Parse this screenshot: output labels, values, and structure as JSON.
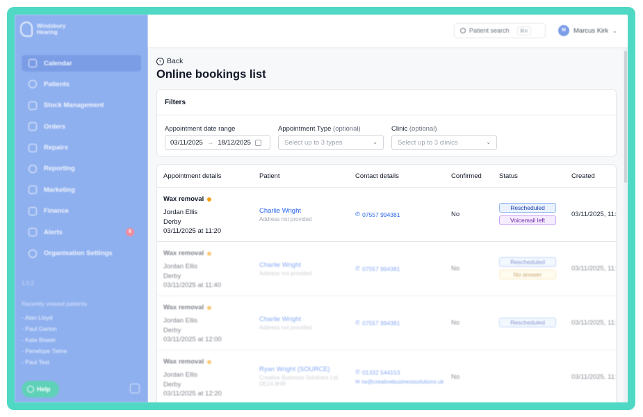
{
  "sidebar": {
    "logo_line1": "Windsbury",
    "logo_line2": "Hearing",
    "items": [
      {
        "label": "Calendar",
        "icon": "calendar-icon"
      },
      {
        "label": "Patients",
        "icon": "patients-icon"
      },
      {
        "label": "Stock Management",
        "icon": "stock-icon"
      },
      {
        "label": "Orders",
        "icon": "orders-icon"
      },
      {
        "label": "Repairs",
        "icon": "wrench-icon"
      },
      {
        "label": "Reporting",
        "icon": "chart-icon"
      },
      {
        "label": "Marketing",
        "icon": "mail-icon"
      },
      {
        "label": "Finance",
        "icon": "card-icon"
      },
      {
        "label": "Alerts",
        "icon": "bell-icon",
        "badge": "6"
      },
      {
        "label": "Organisation Settings",
        "icon": "gear-icon"
      }
    ],
    "version": "1.0.2",
    "recent_title": "Recently viewed patients",
    "recent": [
      "- Alan Lloyd",
      "- Paul Garton",
      "- Kate Bower",
      "- Penelope Twine",
      "- Paul Test"
    ],
    "help_label": "Help"
  },
  "topbar": {
    "search_label": "Patient search",
    "search_shortcut": "⌘K",
    "user_initials": "M",
    "user_name": "Marcus Kirk"
  },
  "page": {
    "back_label": "Back",
    "title": "Online bookings list"
  },
  "filters": {
    "heading": "Filters",
    "date_label": "Appointment date range",
    "date_from": "03/11/2025",
    "date_arrow": "→",
    "date_to": "18/12/2025",
    "type_label": "Appointment Type",
    "type_optional": "(optional)",
    "type_placeholder": "Select up to 3 types",
    "clinic_label": "Clinic",
    "clinic_optional": "(optional)",
    "clinic_placeholder": "Select up to 3 clinics"
  },
  "table": {
    "headers": [
      "Appointment details",
      "Patient",
      "Contact details",
      "Confirmed",
      "Status",
      "Created"
    ],
    "rows": [
      {
        "type": "Wax removal",
        "name": "Jordan Ellis",
        "location": "Derby",
        "datetime": "03/11/2025 at 11:20",
        "patient": "Charlie Wright",
        "address": "Address not provided",
        "phone": "07557 994381",
        "email": "",
        "confirmed": "No",
        "status": [
          {
            "label": "Rescheduled",
            "tone": "blue"
          },
          {
            "label": "Voicemail left",
            "tone": "purple"
          }
        ],
        "created": "03/11/2025, 11:"
      },
      {
        "type": "Wax removal",
        "name": "Jordan Ellis",
        "location": "Derby",
        "datetime": "03/11/2025 at 11:40",
        "patient": "Charlie Wright",
        "address": "Address not provided",
        "phone": "07557 994381",
        "email": "",
        "confirmed": "No",
        "status": [
          {
            "label": "Rescheduled",
            "tone": "blue"
          },
          {
            "label": "No answer",
            "tone": "yellow"
          }
        ],
        "created": "03/11/2025, 11:"
      },
      {
        "type": "Wax removal",
        "name": "Jordan Ellis",
        "location": "Derby",
        "datetime": "03/11/2025 at 12:00",
        "patient": "Charlie Wright",
        "address": "Address not provided",
        "phone": "07557 994381",
        "email": "",
        "confirmed": "No",
        "status": [
          {
            "label": "Rescheduled",
            "tone": "blue"
          }
        ],
        "created": "03/11/2025, 11:"
      },
      {
        "type": "Wax removal",
        "name": "Jordan Ellis",
        "location": "Derby",
        "datetime": "03/11/2025 at 12:20",
        "patient": "Ryan Wright (SOURCE)",
        "address": "Creative Business Solutions Ltd, DE24 8HR",
        "phone": "01332 544153",
        "email": "rw@creativebusinesssolutions.uk",
        "confirmed": "No",
        "status": [],
        "created": "03/11/2025, 11:"
      }
    ]
  },
  "colors": {
    "frame": "#4fd9c4",
    "sidebar": "#8fb0ef",
    "link": "#2563eb",
    "dot": "#f59e0b"
  }
}
